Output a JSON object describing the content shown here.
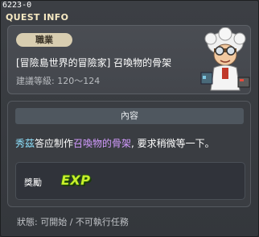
{
  "quest": {
    "id": "6223-0",
    "window_title": "QUEST INFO",
    "category": "職業",
    "name": "[冒險島世界的冒險家] 召喚物的骨架",
    "recommended_level": "建議等級: 120～124"
  },
  "content": {
    "header": "內容",
    "desc_npc": "秀茲",
    "desc_mid": "答应制作",
    "desc_item": "召喚物的骨架",
    "desc_end": ", 要求稍微等一下。",
    "reward_label": "獎勵",
    "reward_icon": "EXP"
  },
  "status_text": "狀態: 可開始 / 不可執行任務",
  "colors": {
    "npc_highlight": "#8fe3ff",
    "item_highlight": "#d39bff",
    "exp_icon": "#c8f02a",
    "title": "#f7e9c2"
  },
  "icons": {
    "npc_portrait": "scientist-npc-icon",
    "exp": "exp-icon"
  }
}
